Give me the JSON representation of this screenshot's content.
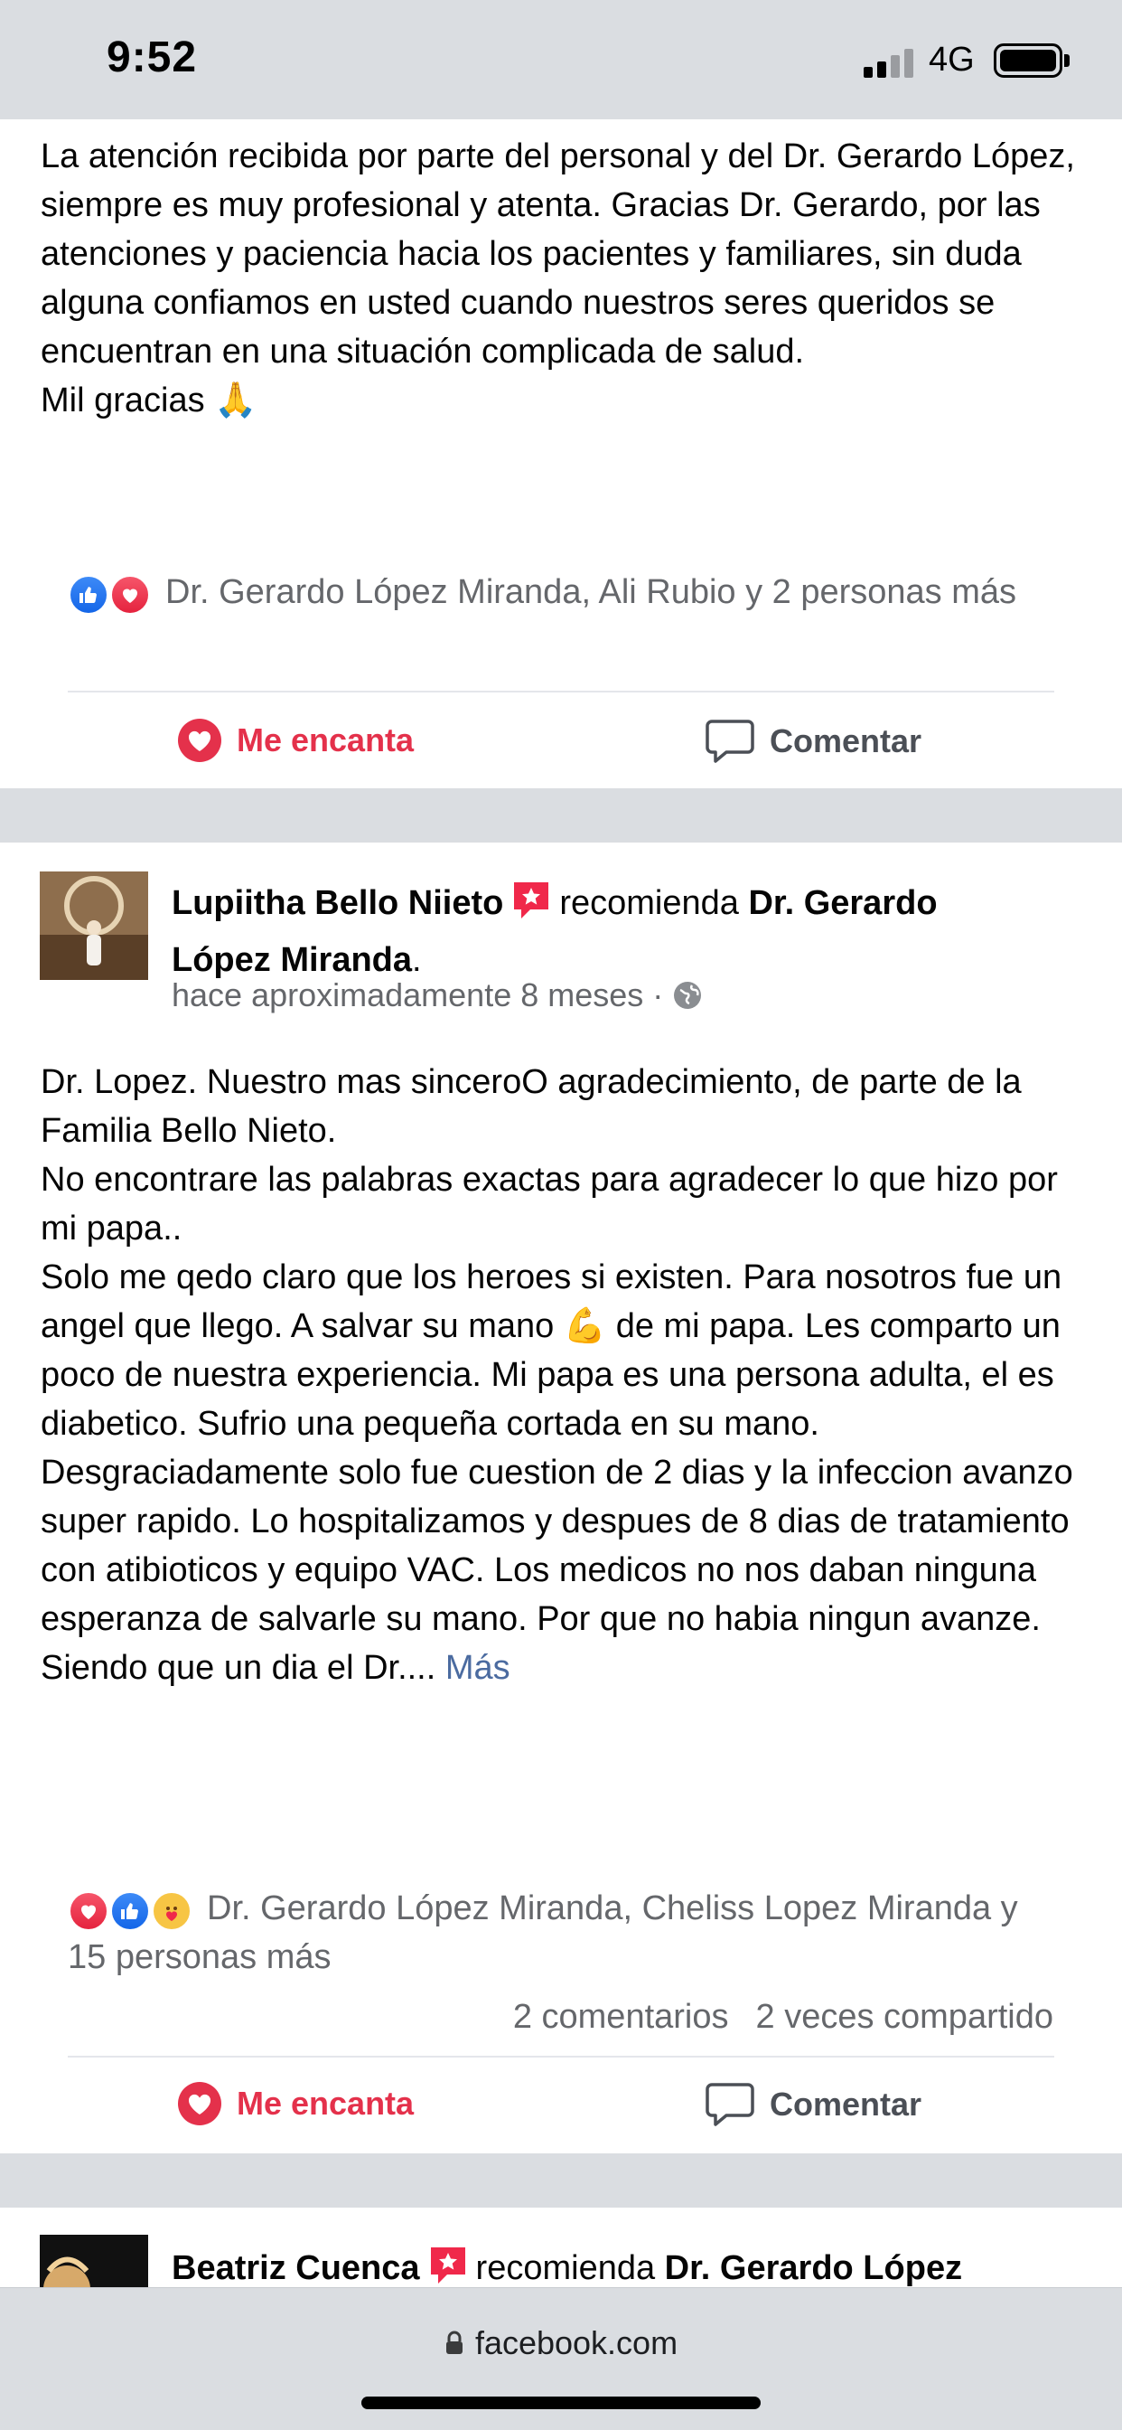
{
  "status_bar": {
    "time": "9:52",
    "network": "4G"
  },
  "post1": {
    "text": "La atención recibida por parte del personal y del Dr. Gerardo López, siempre es muy profesional y atenta. Gracias Dr. Gerardo, por las atenciones y paciencia hacia los pacientes y familiares, sin duda alguna confiamos en usted cuando nuestros seres queridos se encuentran en una situación complicada de salud.\nMil gracias 🙏",
    "reactions_text": "Dr. Gerardo López Miranda, Ali Rubio y 2 personas más",
    "love_label": "Me encanta",
    "comment_label": "Comentar"
  },
  "post2": {
    "author": "Lupiitha Bello Niieto",
    "recommends": "recomienda",
    "page": "Dr. Gerardo López Miranda",
    "period": ".",
    "time": "hace aproximadamente 8 meses ·",
    "text": "Dr. Lopez. Nuestro mas sinceroO agradecimiento, de parte de la Familia Bello Nieto.\nNo encontrare las palabras exactas para agradecer lo que hizo por mi papa..\nSolo me qedo claro que los heroes si existen. Para nosotros fue un angel que llego. A salvar su mano 💪 de mi papa. Les comparto un poco de nuestra experiencia. Mi papa es una persona adulta, el es diabetico. Sufrio una pequeña cortada en su mano. Desgraciadamente solo fue cuestion de 2 dias y la infeccion avanzo super rapido. Lo hospitalizamos y despues de 8 dias de tratamiento con atibioticos y equipo VAC. Los medicos no nos daban ninguna esperanza de salvarle su mano. Por que no habia ningun avanze.\nSiendo que un dia el Dr.... ",
    "more_label": "Más",
    "reactions_text": "Dr. Gerardo López Miranda, Cheliss Lopez Miranda y 15 personas más",
    "comments_count": "2 comentarios",
    "shares_count": "2 veces compartido",
    "love_label": "Me encanta",
    "comment_label": "Comentar"
  },
  "post3": {
    "author": "Beatriz Cuenca",
    "recommends": "recomienda",
    "page": "Dr. Gerardo López"
  },
  "browser": {
    "url": "facebook.com"
  },
  "colors": {
    "love": "#e4314b",
    "like": "#1877f2",
    "secondary_text": "#65676b",
    "link": "#4b6ba0"
  }
}
